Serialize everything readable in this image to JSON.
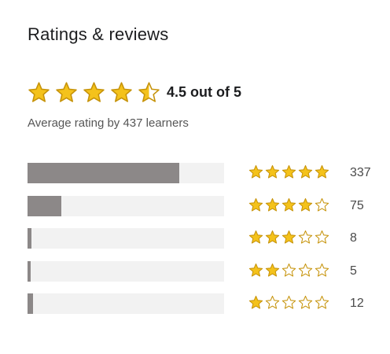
{
  "header": {
    "title": "Ratings & reviews"
  },
  "summary": {
    "rating": 4.5,
    "score_label": "4.5 out of 5",
    "subtitle": "Average rating by 437 learners"
  },
  "breakdown": [
    {
      "stars": 5,
      "count_label": "337",
      "fraction": 0.771
    },
    {
      "stars": 4,
      "count_label": "75",
      "fraction": 0.172
    },
    {
      "stars": 3,
      "count_label": "8",
      "fraction": 0.018
    },
    {
      "stars": 2,
      "count_label": "5",
      "fraction": 0.011
    },
    {
      "stars": 1,
      "count_label": "12",
      "fraction": 0.027
    }
  ],
  "colors": {
    "star_fill": "#f4c21b",
    "star_stroke": "#c6930a",
    "bar_fill": "#8c8888",
    "bar_track": "#f2f2f2"
  },
  "icons": {
    "star": "star-icon",
    "half_star": "half-star-icon",
    "empty_star": "empty-star-icon"
  }
}
